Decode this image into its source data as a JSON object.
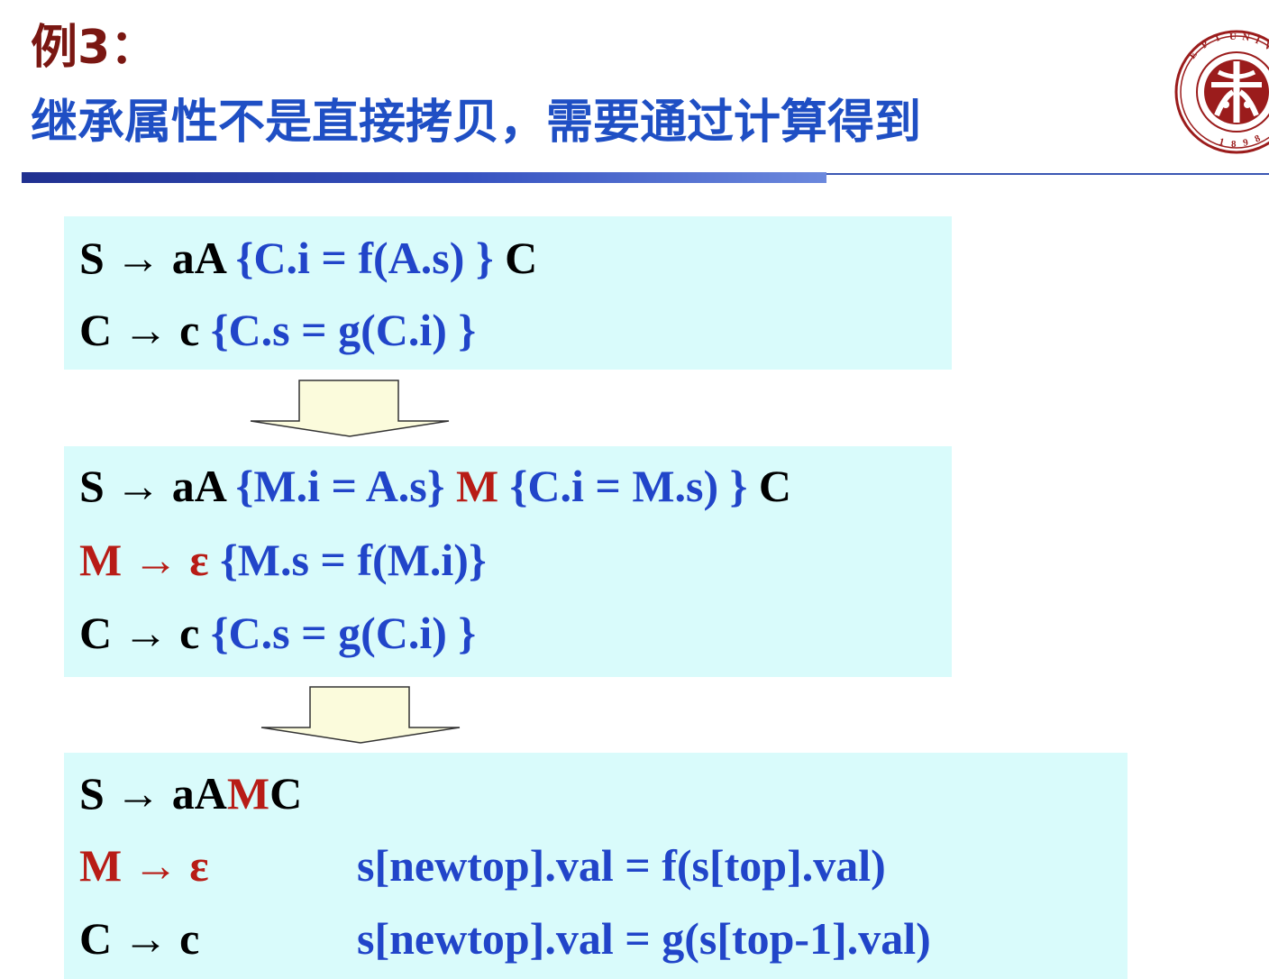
{
  "title": {
    "line1": "例3：",
    "line2": "继承属性不是直接拷贝，需要通过计算得到"
  },
  "logo": {
    "text": "PEKING UNIVERSITY",
    "year": "1898"
  },
  "box1": {
    "rule1": {
      "lhs": "S → aA ",
      "action": "{C.i = f(A.s) }",
      "tail": " C"
    },
    "rule2": {
      "lhs": "C → c ",
      "action": "{C.s = g(C.i) }"
    }
  },
  "box2": {
    "rule1": {
      "lhs": "S → aA ",
      "action1": "{M.i = A.s}",
      "marker": " M ",
      "action2": "{C.i = M.s) }",
      "tail": " C"
    },
    "rule2": {
      "lhs": "M → ε ",
      "action": "{M.s = f(M.i)}"
    },
    "rule3": {
      "lhs": "C → c ",
      "action": "{C.s = g(C.i) }"
    }
  },
  "box3": {
    "rule1": {
      "prefix": "S → aA",
      "marker": "M",
      "suffix": "C"
    },
    "rule2": {
      "lhs": "M → ε",
      "action": "s[newtop].val = f(s[top].val)"
    },
    "rule3": {
      "lhs": "C → c",
      "action": "s[newtop].val = g(s[top-1].val)"
    }
  },
  "colors": {
    "title_dark_red": "#7a1712",
    "title_blue": "#1f4fc4",
    "action_blue": "#2145c9",
    "marker_red": "#b81c16",
    "box_bg": "#d9fbfb",
    "arrow_fill": "#fbfbdc"
  }
}
